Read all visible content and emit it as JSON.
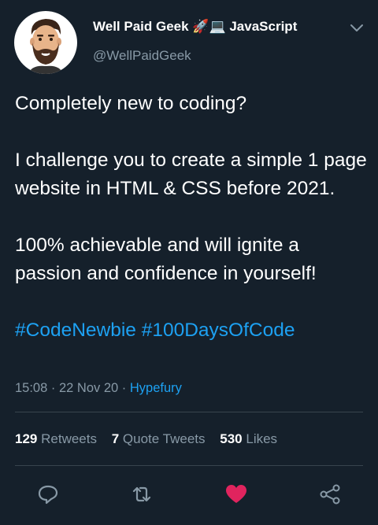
{
  "author": {
    "name": "Well Paid Geek 🚀💻 JavaScript",
    "handle": "@WellPaidGeek"
  },
  "tweet": {
    "line1": "Completely new to coding?",
    "para2": "I challenge you to create a simple 1 page website in HTML & CSS before 2021.",
    "para3": "100% achievable and will ignite a passion and confidence in yourself!",
    "hashtag1": "#CodeNewbie",
    "hashtag2": "#100DaysOfCode"
  },
  "meta": {
    "time": "15:08",
    "date": "22 Nov 20",
    "source": "Hypefury"
  },
  "stats": {
    "retweets_count": "129",
    "retweets_label": "Retweets",
    "quotes_count": "7",
    "quotes_label": "Quote Tweets",
    "likes_count": "530",
    "likes_label": "Likes"
  },
  "icons": {
    "reply": "reply-icon",
    "retweet": "retweet-icon",
    "like": "heart-icon",
    "share": "share-icon",
    "caret": "chevron-down-icon"
  },
  "colors": {
    "background": "#15202b",
    "accent": "#1da1f2",
    "secondary_text": "#8899a6",
    "like": "#e0245e",
    "divider": "#38444d"
  }
}
